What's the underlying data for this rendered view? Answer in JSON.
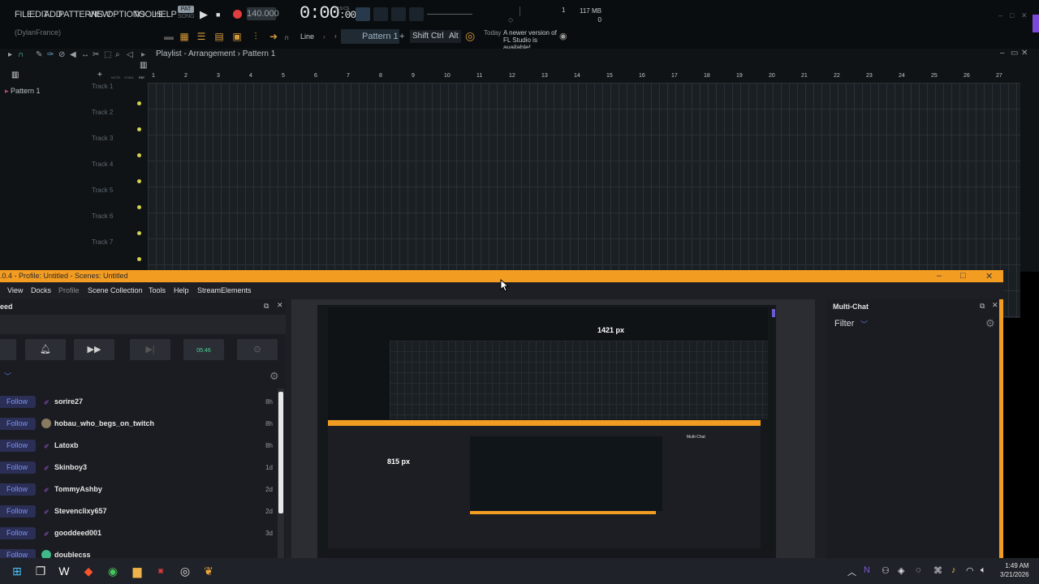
{
  "fl": {
    "menu": [
      "FILE",
      "EDIT",
      "ADD",
      "PATTERNS",
      "VIEW",
      "OPTIONS",
      "TOOLS",
      "HELP"
    ],
    "pat_song": {
      "pat": "PAT",
      "song": "SONG"
    },
    "tempo": "140.000",
    "time": "0:00",
    "time_small": ":00",
    "time_unit": "M:S:CS",
    "cpu": "1",
    "memory": "117 MB",
    "memory2": "0",
    "user": "(DylanFrance)",
    "snap": "Line",
    "pattern_selector": "Pattern 1",
    "pattern_plus": "+",
    "modifiers": [
      "Shift",
      "Ctrl",
      "Alt"
    ],
    "news": {
      "date": "Today",
      "text": "A newer version of FL Studio is available!"
    },
    "playlist": {
      "title": "Playlist - Arrangement",
      "sep": "›",
      "pattern": "Pattern 1",
      "pattern_list_item": "Pattern 1",
      "ruler": [
        "1",
        "2",
        "3",
        "4",
        "5",
        "6",
        "7",
        "8",
        "9",
        "10",
        "11",
        "12",
        "13",
        "14",
        "15",
        "16",
        "17",
        "18",
        "19",
        "20",
        "21",
        "22",
        "23",
        "24",
        "25",
        "26",
        "27"
      ],
      "tracks": [
        "Track 1",
        "Track 2",
        "Track 3",
        "Track 4",
        "Track 5",
        "Track 6",
        "Track 7"
      ],
      "col_labels": [
        "NOTE",
        "CHAN",
        "PAT"
      ]
    }
  },
  "obs": {
    "title": ".0.4 - Profile: Untitled - Scenes: Untitled",
    "menu": [
      "View",
      "Docks",
      "Profile",
      "Scene Collection",
      "Tools",
      "Help",
      "StreamElements"
    ],
    "left_dock_title": "eed",
    "timer": "05:46",
    "follow_label": "Follow",
    "feed": [
      {
        "name": "sorire27",
        "time": "8h"
      },
      {
        "name": "hobau_who_begs_on_twitch",
        "time": "8h"
      },
      {
        "name": "Latoxb",
        "time": "8h"
      },
      {
        "name": "Skinboy3",
        "time": "1d"
      },
      {
        "name": "TommyAshby",
        "time": "2d"
      },
      {
        "name": "Stevenclixy657",
        "time": "2d"
      },
      {
        "name": "gooddeed001",
        "time": "3d"
      },
      {
        "name": "doublecss",
        "time": ""
      }
    ],
    "preview": {
      "width_label": "1421 px",
      "height_label": "815 px"
    },
    "multichat": {
      "title": "Multi-Chat",
      "filter": "Filter"
    }
  },
  "taskbar": {
    "time": "1:49 AM",
    "date": "3/21/2026"
  },
  "colors": {
    "obs_accent": "#f39c22",
    "follow_bg": "#2b2f55",
    "follow_text": "#7d93f5",
    "fl_bg": "#0f1316"
  }
}
